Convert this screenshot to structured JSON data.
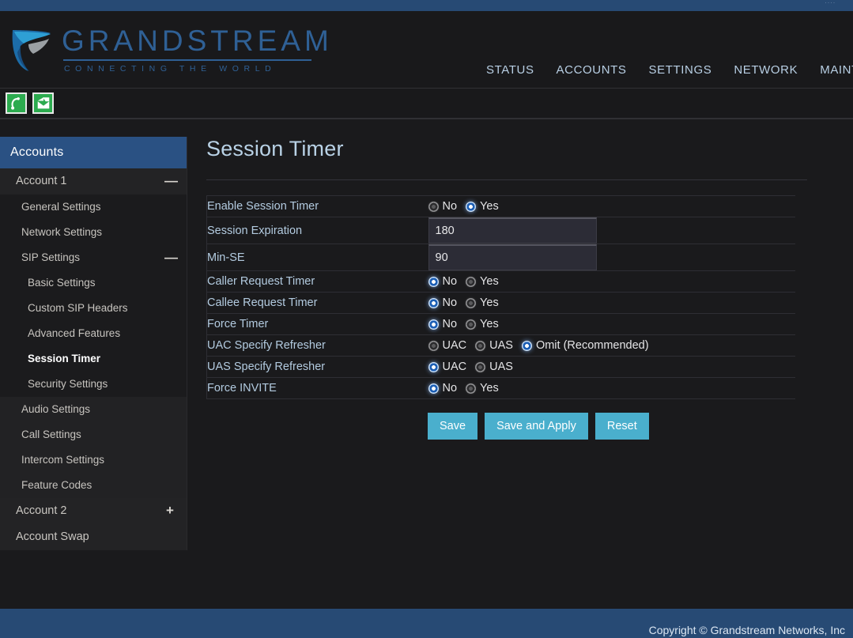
{
  "topbar": {
    "ghost_text": "····"
  },
  "brand": {
    "wordmark": "GRANDSTREAM",
    "tagline": "CONNECTING THE WORLD",
    "logo_icon": "grandstream-swoosh-logo"
  },
  "topnav": {
    "items": [
      {
        "label": "STATUS"
      },
      {
        "label": "ACCOUNTS"
      },
      {
        "label": "SETTINGS"
      },
      {
        "label": "NETWORK"
      },
      {
        "label": "MAINT"
      }
    ]
  },
  "iconbar": {
    "icons": [
      {
        "name": "phone-handset-icon",
        "glyph": "✆"
      },
      {
        "name": "voicemail-envelope-icon",
        "glyph": "✉"
      }
    ],
    "accent_green": "#2cab4f"
  },
  "sidebar": {
    "header": "Accounts",
    "items": [
      {
        "label": "Account 1",
        "level": 1,
        "toggle": "—",
        "active": false
      },
      {
        "label": "General Settings",
        "level": 2,
        "toggle": "",
        "active": false
      },
      {
        "label": "Network Settings",
        "level": 2,
        "toggle": "",
        "active": false
      },
      {
        "label": "SIP Settings",
        "level": 2,
        "toggle": "—",
        "active": false
      },
      {
        "label": "Basic Settings",
        "level": 3,
        "toggle": "",
        "active": false
      },
      {
        "label": "Custom SIP Headers",
        "level": 3,
        "toggle": "",
        "active": false
      },
      {
        "label": "Advanced Features",
        "level": 3,
        "toggle": "",
        "active": false
      },
      {
        "label": "Session Timer",
        "level": 3,
        "toggle": "",
        "active": true
      },
      {
        "label": "Security Settings",
        "level": 3,
        "toggle": "",
        "active": false
      },
      {
        "label": "Audio Settings",
        "level": 2,
        "toggle": "",
        "active": false
      },
      {
        "label": "Call Settings",
        "level": 2,
        "toggle": "",
        "active": false
      },
      {
        "label": "Intercom Settings",
        "level": 2,
        "toggle": "",
        "active": false
      },
      {
        "label": "Feature Codes",
        "level": 2,
        "toggle": "",
        "active": false
      },
      {
        "label": "Account 2",
        "level": 1,
        "toggle": "+",
        "active": false
      },
      {
        "label": "Account Swap",
        "level": 1,
        "toggle": "",
        "active": false
      }
    ]
  },
  "main": {
    "title": "Session Timer",
    "rows": [
      {
        "label": "Enable Session Timer",
        "type": "radio",
        "options": [
          {
            "label": "No",
            "selected": false
          },
          {
            "label": "Yes",
            "selected": true
          }
        ]
      },
      {
        "label": "Session Expiration",
        "type": "text",
        "value": "180"
      },
      {
        "label": "Min-SE",
        "type": "text",
        "value": "90"
      },
      {
        "label": "Caller Request Timer",
        "type": "radio",
        "options": [
          {
            "label": "No",
            "selected": true
          },
          {
            "label": "Yes",
            "selected": false
          }
        ]
      },
      {
        "label": "Callee Request Timer",
        "type": "radio",
        "options": [
          {
            "label": "No",
            "selected": true
          },
          {
            "label": "Yes",
            "selected": false
          }
        ]
      },
      {
        "label": "Force Timer",
        "type": "radio",
        "options": [
          {
            "label": "No",
            "selected": true
          },
          {
            "label": "Yes",
            "selected": false
          }
        ]
      },
      {
        "label": "UAC Specify Refresher",
        "type": "radio",
        "options": [
          {
            "label": "UAC",
            "selected": false
          },
          {
            "label": "UAS",
            "selected": false
          },
          {
            "label": "Omit (Recommended)",
            "selected": true
          }
        ]
      },
      {
        "label": "UAS Specify Refresher",
        "type": "radio",
        "options": [
          {
            "label": "UAC",
            "selected": true
          },
          {
            "label": "UAS",
            "selected": false
          }
        ]
      },
      {
        "label": "Force INVITE",
        "type": "radio",
        "options": [
          {
            "label": "No",
            "selected": true
          },
          {
            "label": "Yes",
            "selected": false
          }
        ]
      }
    ],
    "buttons": [
      {
        "label": "Save"
      },
      {
        "label": "Save and Apply"
      },
      {
        "label": "Reset"
      }
    ]
  },
  "footer": {
    "copyright": "Copyright © Grandstream Networks, Inc"
  },
  "colors": {
    "brand_blue": "#2f6095",
    "header_blue": "#274a74",
    "sidebar_header": "#2a5183",
    "button_blue": "#4aafcd",
    "radio_on": "#1d5fb5",
    "page_bg": "#1a1a1c"
  }
}
